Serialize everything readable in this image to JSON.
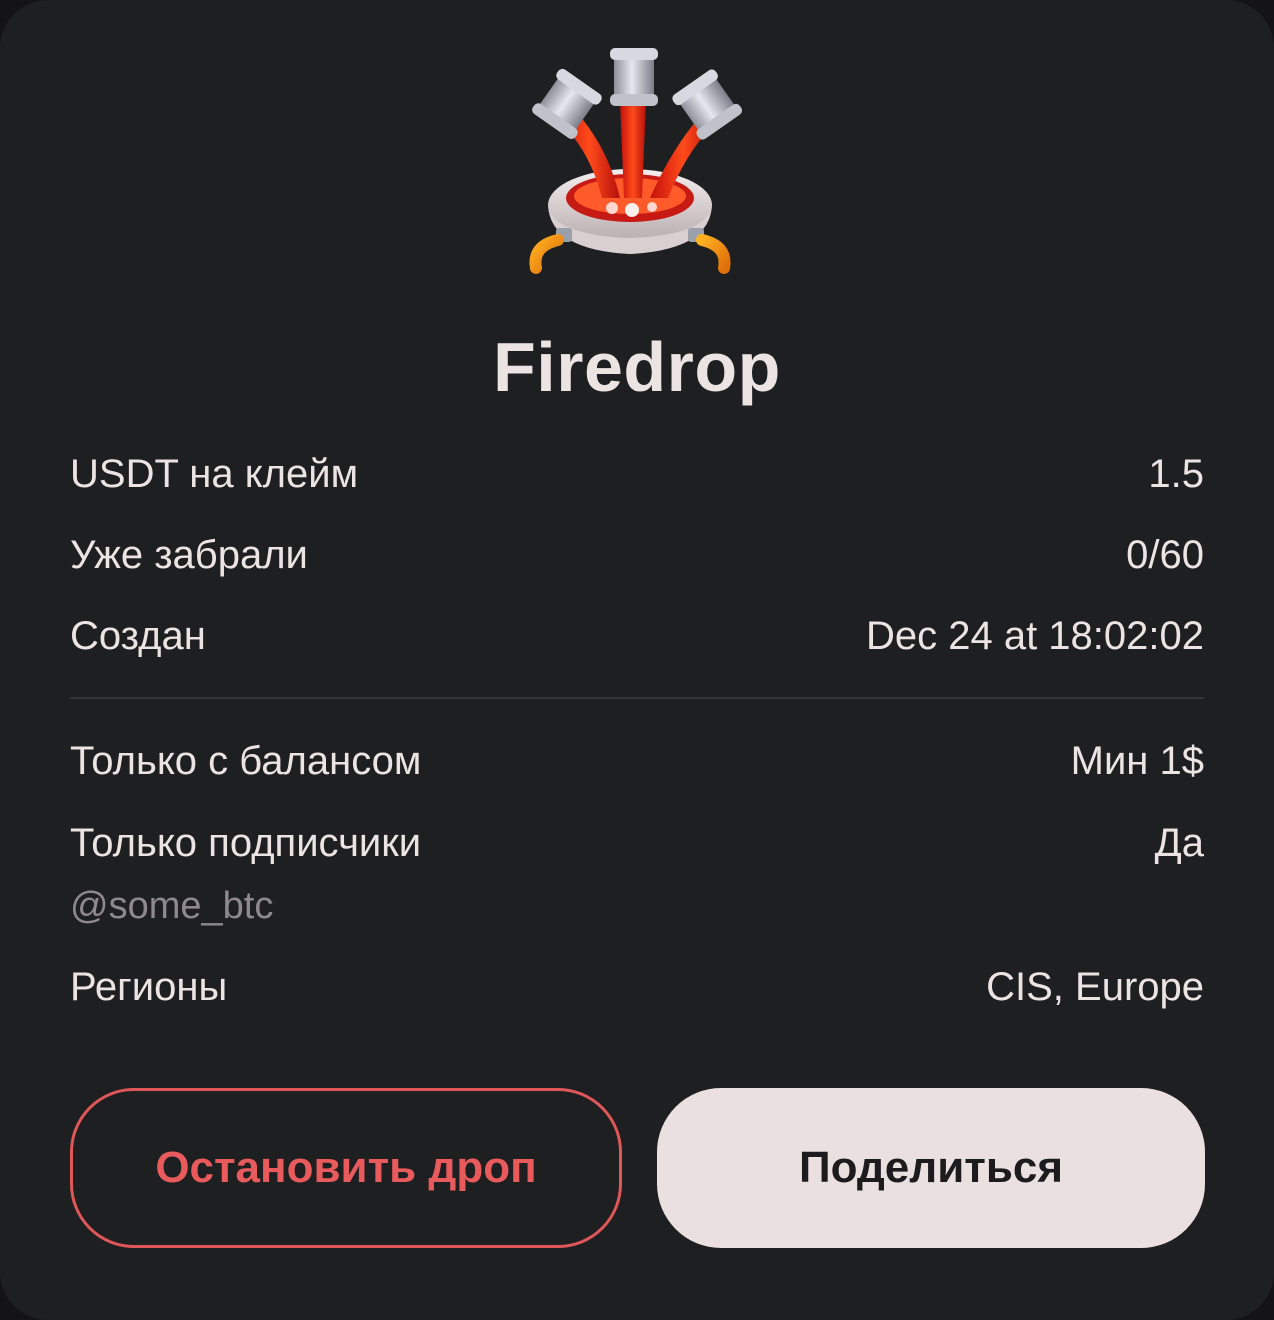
{
  "app": {
    "title": "Firedrop",
    "logo_icon": "fire-pipes-cauldron-icon"
  },
  "details": {
    "usdt_per_claim": {
      "label": "USDT на клейм",
      "value": "1.5"
    },
    "claimed": {
      "label": "Уже забрали",
      "value": "0/60"
    },
    "created": {
      "label": "Создан",
      "value": "Dec 24 at 18:02:02"
    }
  },
  "conditions": {
    "balance_only": {
      "label": "Только с балансом",
      "value": "Мин 1$"
    },
    "subscribers_only": {
      "label": "Только подписчики",
      "value": "Да",
      "channel": "@some_btc"
    },
    "regions": {
      "label": "Регионы",
      "value": "CIS, Europe"
    }
  },
  "actions": {
    "stop_label": "Остановить дроп",
    "share_label": "Поделиться"
  },
  "colors": {
    "background": "#1e1f21",
    "text": "#ece3e3",
    "muted": "#8e8a8b",
    "danger": "#e85a5c",
    "share_button": "#ebe0e0"
  }
}
